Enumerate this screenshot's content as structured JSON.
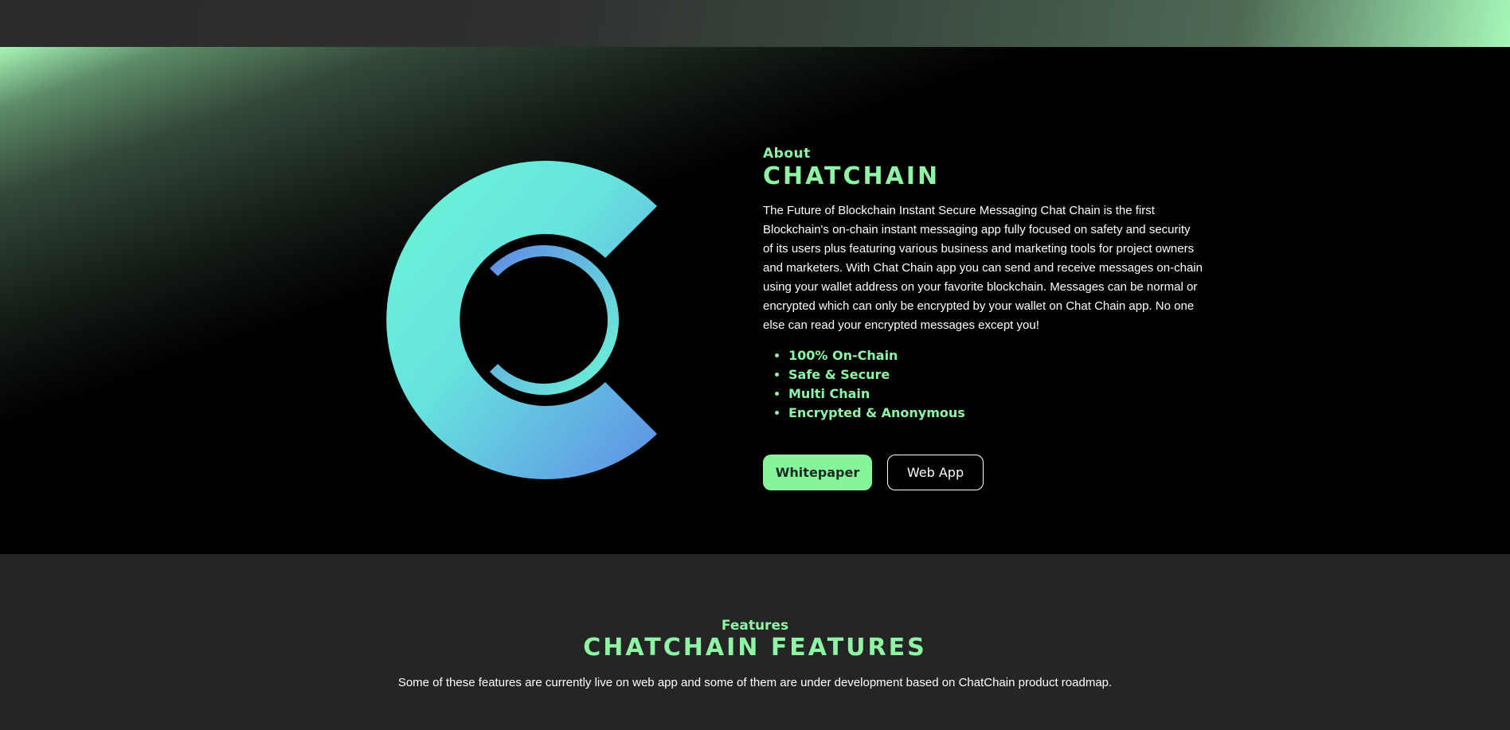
{
  "colors": {
    "accent": "#86f49a",
    "accent_text": "#8ef5a4",
    "logo_gradient_start": "#69f4d8",
    "logo_gradient_end": "#6496e8",
    "page_background": "#252525",
    "about_background": "#000000"
  },
  "about": {
    "eyebrow": "About",
    "title": "CHATCHAIN",
    "logo_icon": "chatchain-c-logo",
    "description": "The Future of Blockchain Instant Secure Messaging Chat Chain is the first Blockchain's on-chain instant messaging app fully focused on safety and security of its users plus featuring various business and marketing tools for project owners and marketers. With Chat Chain app you can send and receive messages on-chain using your wallet address on your favorite blockchain. Messages can be normal or encrypted which can only be encrypted by your wallet on Chat Chain app. No one else can read your encrypted messages except you!",
    "bullets": [
      "100% On-Chain",
      "Safe & Secure",
      "Multi Chain",
      "Encrypted & Anonymous"
    ],
    "buttons": {
      "whitepaper": "Whitepaper",
      "web_app": "Web App"
    }
  },
  "features": {
    "eyebrow": "Features",
    "title": "CHATCHAIN FEATURES",
    "description": "Some of these features are currently live on web app and some of them are under development based on ChatChain product roadmap."
  }
}
